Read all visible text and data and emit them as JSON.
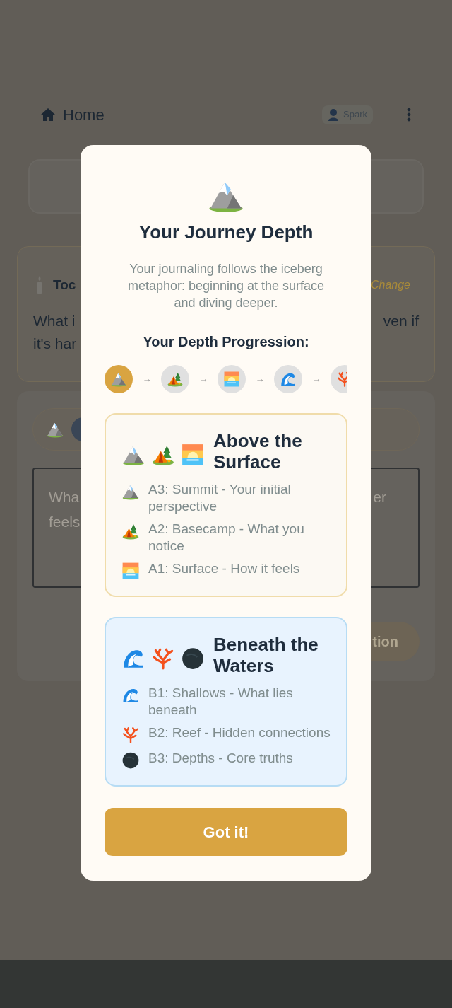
{
  "header": {
    "title": "Home",
    "chip": "Spark"
  },
  "prompt_card": {
    "title": "Toc",
    "action": "Change",
    "question_left": [
      "What i",
      "it's har"
    ],
    "question_right": [
      "ven if"
    ]
  },
  "entry_card": {
    "placeholder_left": [
      "Wha",
      "feels"
    ],
    "placeholder_right": [
      "er"
    ],
    "button": "tion"
  },
  "dialog": {
    "title": "Your Journey Depth",
    "description": "Your journaling follows the iceberg metaphor: beginning at the surface and diving deeper.",
    "progression_title": "Your Depth Progression:",
    "steps": [
      {
        "kind": "mountain",
        "selected": true
      },
      {
        "kind": "tent",
        "selected": false,
        "arrow": "→"
      },
      {
        "kind": "sunrise",
        "selected": false,
        "arrow": "→"
      },
      {
        "kind": "wave",
        "selected": false,
        "arrow": "→"
      },
      {
        "kind": "coral",
        "selected": false,
        "arrow": "→"
      }
    ],
    "sections": [
      {
        "kind": "surface",
        "title": "Above the Surface",
        "icons": [
          {
            "kind": "mountain"
          },
          {
            "kind": "tent"
          },
          {
            "kind": "sunrise"
          }
        ],
        "items": [
          {
            "kind": "mountain",
            "text": "A3: Summit - Your initial perspective"
          },
          {
            "kind": "tent",
            "text": "A2: Basecamp - What you notice"
          },
          {
            "kind": "sunrise",
            "text": "A1: Surface - How it feels"
          }
        ]
      },
      {
        "kind": "deep",
        "title": "Beneath the Waters",
        "icons": [
          {
            "kind": "wave"
          },
          {
            "kind": "coral"
          },
          {
            "kind": "depths"
          }
        ],
        "items": [
          {
            "kind": "wave",
            "text": "B1: Shallows - What lies beneath"
          },
          {
            "kind": "coral",
            "text": "B2: Reef - Hidden connections"
          },
          {
            "kind": "depths",
            "text": "B3: Depths - Core truths"
          }
        ]
      }
    ],
    "button": "Got it!"
  }
}
